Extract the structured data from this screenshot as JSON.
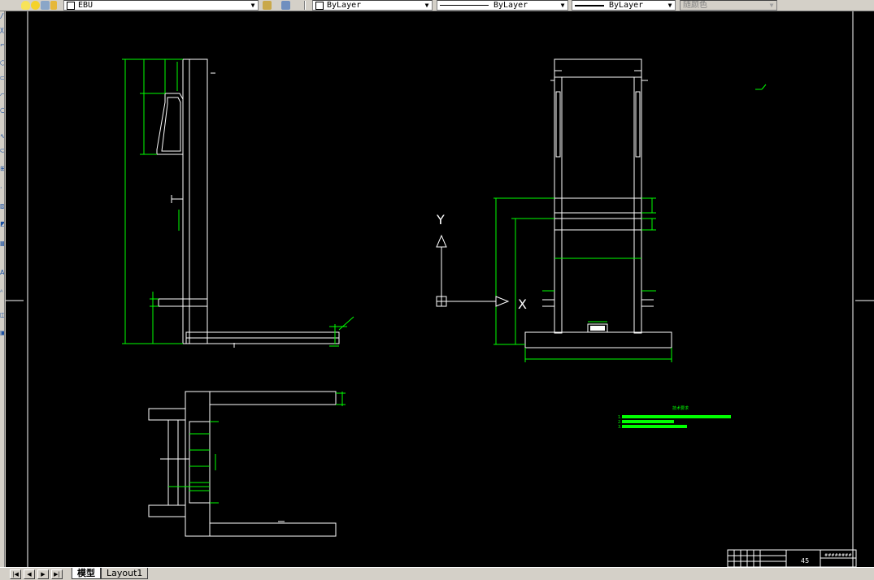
{
  "toolbar": {
    "layer_name": "EBU",
    "color": "ByLayer",
    "linetype": "ByLayer",
    "lineweight": "ByLayer",
    "plot_style": "随颜色"
  },
  "tabs": {
    "model": "模型",
    "layout1": "Layout1"
  },
  "ucs": {
    "y_label": "Y",
    "x_label": "X"
  },
  "title_block": {
    "sheet_number": "45",
    "drawing_name": "########"
  },
  "notes": {
    "heading": "技术要求",
    "lines": [
      "1.",
      "2.",
      "3."
    ]
  },
  "colors": {
    "background": "#000000",
    "geometry": "#ffffff",
    "dimension": "#00ff00",
    "notes": "#00ff00"
  }
}
